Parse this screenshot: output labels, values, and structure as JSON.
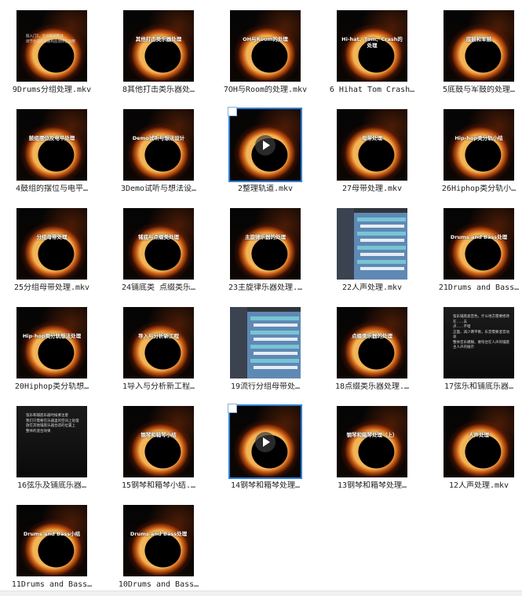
{
  "files": [
    {
      "name": "9Drums分组处理.mkv",
      "thumb": {
        "kind": "left",
        "lines": [
          "鼓入门5，针对鼓组整体",
          "调节合成的音质和反馈修正调整"
        ]
      }
    },
    {
      "name": "8其他打击类乐器处…",
      "thumb": {
        "kind": "title",
        "text": "其他打击类乐器处理"
      }
    },
    {
      "name": "7OH与Room的处理.mkv",
      "thumb": {
        "kind": "title",
        "text": "OH与Room的处理"
      }
    },
    {
      "name": "6 Hihat Tom Crash…",
      "thumb": {
        "kind": "title",
        "text": "Hi-hat、Tom、Crash的处理"
      }
    },
    {
      "name": "5底鼓与军鼓的处理…",
      "thumb": {
        "kind": "title",
        "text": "底鼓和军鼓"
      }
    },
    {
      "name": "4鼓组的摆位与电平…",
      "thumb": {
        "kind": "title",
        "text": "鼓组摆位及电平处理"
      }
    },
    {
      "name": "3Demo试听与想法设…",
      "thumb": {
        "kind": "title",
        "text": "Demo试听与想法设计"
      }
    },
    {
      "name": "2整理轨道.mkv",
      "thumb": {
        "kind": "video"
      },
      "selected": true
    },
    {
      "name": "27母带处理.mkv",
      "thumb": {
        "kind": "title",
        "text": "母带处理"
      }
    },
    {
      "name": "26Hiphop类分轨小…",
      "thumb": {
        "kind": "title",
        "text": "Hip-hop类分轨小结"
      }
    },
    {
      "name": "25分组母带处理.mkv",
      "thumb": {
        "kind": "title",
        "text": "分组母带处理"
      }
    },
    {
      "name": "24铺底类 点缀类乐…",
      "thumb": {
        "kind": "title",
        "text": "铺底与点缀类处理"
      }
    },
    {
      "name": "23主旋律乐器处理.…",
      "thumb": {
        "kind": "title",
        "text": "主旋律乐器的处理"
      }
    },
    {
      "name": "22人声处理.mkv",
      "thumb": {
        "kind": "daw"
      }
    },
    {
      "name": "21Drums and Bass…",
      "thumb": {
        "kind": "title",
        "text": "Drums and Bass处理"
      }
    },
    {
      "name": "20Hiphop类分轨想…",
      "thumb": {
        "kind": "title",
        "text": "Hip-hop类分轨想法处理"
      }
    },
    {
      "name": "1导入与分析新工程…",
      "thumb": {
        "kind": "title",
        "text": "导入与分析新工程"
      }
    },
    {
      "name": "19流行分组母带处…",
      "thumb": {
        "kind": "daw"
      }
    },
    {
      "name": "18点缀类乐器处理.…",
      "thumb": {
        "kind": "title",
        "text": "点缀类乐器的处理"
      }
    },
    {
      "name": "17弦乐和铺底乐器…",
      "thumb": {
        "kind": "plain",
        "lines": [
          "弦乐铺底类音色，什么地方需要修改",
          "在……去",
          "点……不错",
          "正面，减少两平衡，乐音需要混音动总",
          "整体音乐模糊，要符合在人声的铺底",
          "主人声的展示"
        ]
      }
    },
    {
      "name": "16弦乐及铺底乐器…",
      "thumb": {
        "kind": "plain",
        "lines": [
          "弦乐和铺底乐器时候要注意",
          "我们只需要在乐器里的空间上处理",
          "放在其他铺底乐器合适的位置上",
          "整体的混合效果"
        ]
      }
    },
    {
      "name": "15钢琴和箱琴小结.…",
      "thumb": {
        "kind": "title",
        "text": "钢琴和箱琴小结"
      }
    },
    {
      "name": "14钢琴和箱琴处理…",
      "thumb": {
        "kind": "video"
      },
      "selected": true
    },
    {
      "name": "13钢琴和箱琴处理…",
      "thumb": {
        "kind": "title",
        "text": "钢琴和箱琴处理（上）"
      }
    },
    {
      "name": "12人声处理.mkv",
      "thumb": {
        "kind": "title",
        "text": "人声处理"
      }
    },
    {
      "name": "11Drums and Bass…",
      "thumb": {
        "kind": "title",
        "text": "Drums and Bass小结"
      }
    },
    {
      "name": "10Drums and Bass…",
      "thumb": {
        "kind": "title",
        "text": "Drums and Bass处理"
      }
    }
  ]
}
